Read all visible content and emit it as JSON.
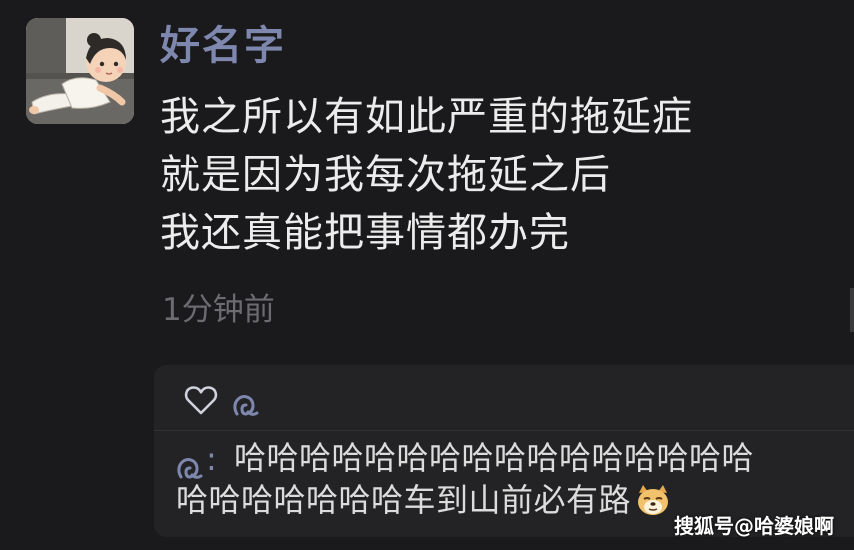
{
  "post": {
    "username": "好名字",
    "lines": [
      "我之所以有如此严重的拖延症",
      "就是因为我每次拖延之后",
      "我还真能把事情都办完"
    ],
    "timestamp": "1分钟前"
  },
  "interactions": {
    "like_icon": "heart-icon",
    "like_names_icon": "user-glyph-icon",
    "comment": {
      "author_icon": "user-glyph-icon",
      "colon": ":",
      "text_line1": "哈哈哈哈哈哈哈哈哈哈哈哈哈哈哈哈",
      "text_line2": "哈哈哈哈哈哈哈车到山前必有路",
      "emoji": "doge-emoji"
    }
  },
  "watermark": "搜狐号@哈婆娘啊",
  "colors": {
    "background": "#1a1a1c",
    "username": "#7e87ad",
    "text": "#ececec",
    "muted": "#6b6b70",
    "panel": "#232325"
  }
}
